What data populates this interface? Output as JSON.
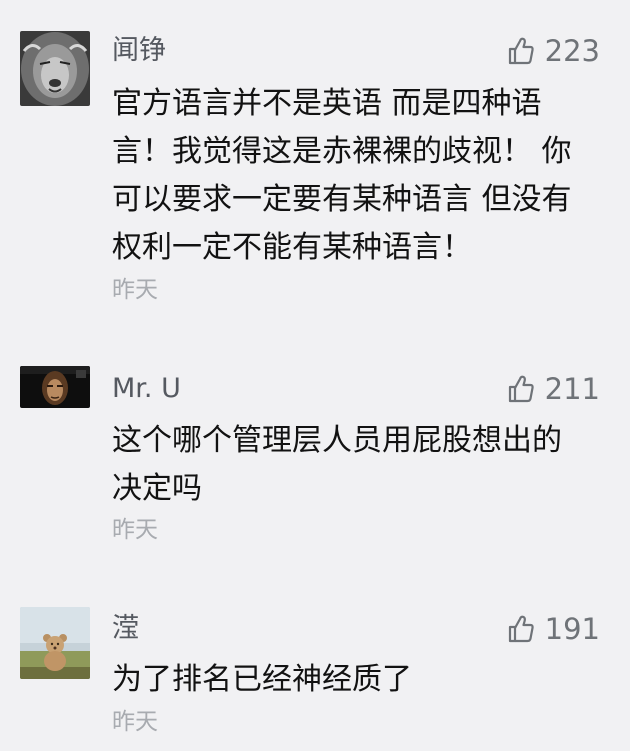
{
  "comments": [
    {
      "avatar_icon": "lion-avatar",
      "name": "闻铮",
      "like_icon": "thumbs-up-icon",
      "likes": "223",
      "content": "官方语言并不是英语 而是四种语\n言！我觉得这是赤裸裸的歧视！ 你\n可以要求一定要有某种语言 但没有\n权利一定不能有某种语言！",
      "time": "昨天"
    },
    {
      "avatar_icon": "person-avatar",
      "name": "Mr. U",
      "like_icon": "thumbs-up-icon",
      "likes": "211",
      "content": "这个哪个管理层人员用屁股想出的\n决定吗",
      "time": "昨天"
    },
    {
      "avatar_icon": "teddy-bear-avatar",
      "name": "滢",
      "like_icon": "thumbs-up-icon",
      "likes": "191",
      "content": "为了排名已经神经质了",
      "time": "昨天"
    }
  ],
  "colors": {
    "background": "#f1f1f3",
    "name": "#555960",
    "content": "#121212",
    "time": "#a8abb0",
    "likes": "#6f7378"
  }
}
